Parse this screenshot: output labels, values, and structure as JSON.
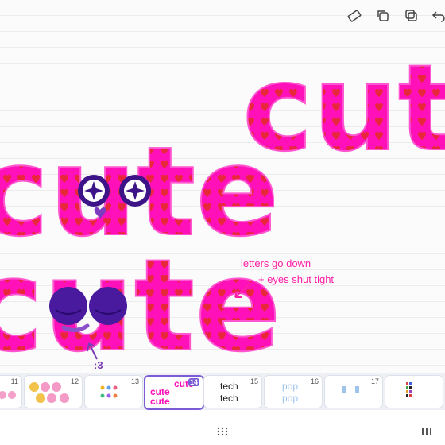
{
  "toolbar": {
    "icons": [
      "ruler-icon",
      "duplicate-icon",
      "copy-icon",
      "undo-icon"
    ]
  },
  "canvas": {
    "words": {
      "top_right": "cute",
      "middle": "cute",
      "bottom": "cute"
    },
    "annotation_lines": [
      "letters go down",
      "+ eyes shut tight"
    ],
    "face_label": ":3",
    "colors": {
      "letters": "#ff10b8",
      "hearts": "#e8283a",
      "eyes": "#4a1a9e",
      "annotation": "#ff1fa6"
    }
  },
  "pages": [
    {
      "number": "11",
      "active": false
    },
    {
      "number": "12",
      "active": false
    },
    {
      "number": "13",
      "active": false
    },
    {
      "number": "14",
      "active": true,
      "words": [
        "cute",
        "cute",
        "cute"
      ]
    },
    {
      "number": "15",
      "active": false,
      "words": [
        "tech",
        "tech"
      ]
    },
    {
      "number": "16",
      "active": false,
      "words": [
        "pop",
        "pop"
      ]
    },
    {
      "number": "17",
      "active": false
    },
    {
      "number": "",
      "active": false
    }
  ]
}
